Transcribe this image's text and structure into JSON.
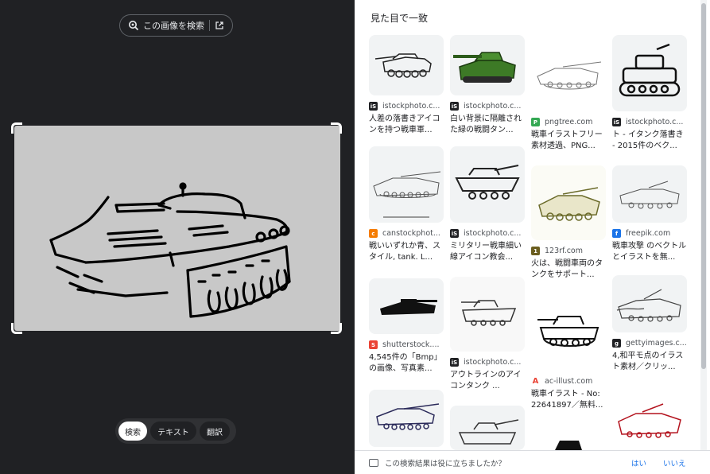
{
  "left": {
    "search_button": "この画像を検索",
    "modes": [
      "検索",
      "テキスト",
      "翻訳"
    ]
  },
  "right": {
    "title": "見た目で一致",
    "feedback_question": "この検索結果は役に立ちましたか？",
    "feedback_yes": "はい",
    "feedback_no": "いいえ",
    "cards": [
      {
        "source": "istockphoto.c...",
        "title": "人差の落書きアイコンを持つ戦車軍...",
        "fav": "iS",
        "fav_color": "#202124"
      },
      {
        "source": "istockphoto.c...",
        "title": "白い背景に隔離された緑の戦闘タン...",
        "fav": "iS",
        "fav_color": "#202124"
      },
      {
        "source": "pngtree.com",
        "title": "戦車イラストフリー素材透過、PNG...",
        "fav": "P",
        "fav_color": "#34a853"
      },
      {
        "source": "istockphoto.c...",
        "title": "ト - イタンク落書き - 2015件のベク...",
        "fav": "iS",
        "fav_color": "#202124"
      },
      {
        "source": "canstockphot...",
        "title": "戦いいずれか青、スタイル, tank. L...",
        "fav": "c",
        "fav_color": "#f57c00"
      },
      {
        "source": "istockphoto.c...",
        "title": "ミリタリー戦車細い線アイコン教会...",
        "fav": "iS",
        "fav_color": "#202124"
      },
      {
        "source": "123rf.com",
        "title": "火は、戦闘車両のタンクをサポート...",
        "fav": "1",
        "fav_color": "#6b5e1f"
      },
      {
        "source": "freepik.com",
        "title": "戦車攻撃 のベクトルとイラストを無...",
        "fav": "f",
        "fav_color": "#1a73e8"
      },
      {
        "source": "shutterstock....",
        "title": "4,545件の「Bmp」の画像、写真素...",
        "fav": "S",
        "fav_color": "#ea4335"
      },
      {
        "source": "istockphoto.c...",
        "title": "アウトラインのアイコンタンク ...",
        "fav": "iS",
        "fav_color": "#202124"
      },
      {
        "source": "ac-illust.com",
        "title": "戦車イラスト - No: 22641897／無料...",
        "fav": "A",
        "fav_color": "#ea4335"
      },
      {
        "source": "gettyimages.c...",
        "title": "4,和平モ点のイラスト素材／クリッ...",
        "fav": "g",
        "fav_color": "#202124"
      },
      {
        "source": "",
        "title": "",
        "fav": "",
        "fav_color": "#ffffff"
      },
      {
        "source": "",
        "title": "",
        "fav": "",
        "fav_color": "#ffffff"
      },
      {
        "source": "",
        "title": "",
        "fav": "",
        "fav_color": "#ffffff"
      },
      {
        "source": "",
        "title": "",
        "fav": "",
        "fav_color": "#ffffff"
      }
    ]
  }
}
